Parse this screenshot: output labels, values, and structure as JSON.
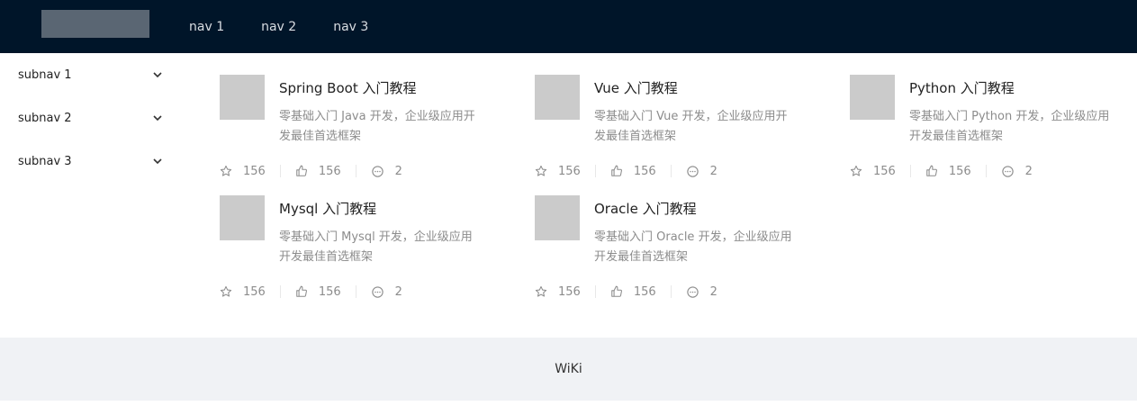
{
  "header": {
    "nav": [
      "nav 1",
      "nav 2",
      "nav 3"
    ]
  },
  "sidebar": {
    "items": [
      {
        "label": "subnav 1",
        "icon": "chevron-down-icon"
      },
      {
        "label": "subnav 2",
        "icon": "chevron-down-icon"
      },
      {
        "label": "subnav 3",
        "icon": "chevron-down-icon"
      }
    ]
  },
  "cards": [
    {
      "title": "Spring Boot 入门教程",
      "desc": "零基础入门 Java 开发，企业级应用开发最佳首选框架",
      "stars": "156",
      "likes": "156",
      "comments": "2"
    },
    {
      "title": "Vue 入门教程",
      "desc": "零基础入门 Vue 开发，企业级应用开发最佳首选框架",
      "stars": "156",
      "likes": "156",
      "comments": "2"
    },
    {
      "title": "Python 入门教程",
      "desc": "零基础入门 Python 开发，企业级应用开发最佳首选框架",
      "stars": "156",
      "likes": "156",
      "comments": "2"
    },
    {
      "title": "Mysql 入门教程",
      "desc": "零基础入门 Mysql 开发，企业级应用开发最佳首选框架",
      "stars": "156",
      "likes": "156",
      "comments": "2"
    },
    {
      "title": "Oracle 入门教程",
      "desc": "零基础入门 Oracle 开发，企业级应用开发最佳首选框架",
      "stars": "156",
      "likes": "156",
      "comments": "2"
    }
  ],
  "footer": {
    "text": "WiKi"
  },
  "colors": {
    "header_bg": "#001529",
    "footer_bg": "#f0f2f5",
    "thumb": "#cbcbcb",
    "muted_text": "#8c8c8c"
  }
}
